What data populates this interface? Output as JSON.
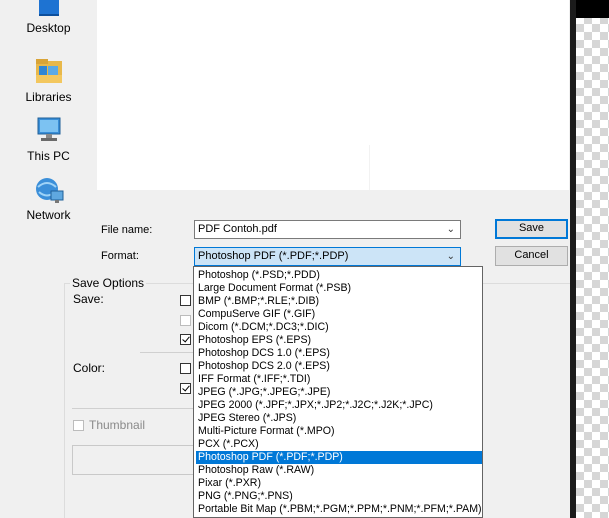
{
  "places": [
    {
      "label": "Desktop",
      "icon": "desktop-icon"
    },
    {
      "label": "Libraries",
      "icon": "libraries-icon"
    },
    {
      "label": "This PC",
      "icon": "this-pc-icon"
    },
    {
      "label": "Network",
      "icon": "network-icon"
    }
  ],
  "file_name": {
    "label": "File name:",
    "value": "PDF Contoh.pdf"
  },
  "format": {
    "label": "Format:",
    "value": "Photoshop PDF (*.PDF;*.PDP)"
  },
  "buttons": {
    "save": "Save",
    "cancel": "Cancel"
  },
  "save_options": {
    "title": "Save Options",
    "save_label": "Save:",
    "color_label": "Color:",
    "thumbnail_label": "Thumbnail"
  },
  "format_options": [
    "Photoshop (*.PSD;*.PDD)",
    "Large Document Format (*.PSB)",
    "BMP (*.BMP;*.RLE;*.DIB)",
    "CompuServe GIF (*.GIF)",
    "Dicom (*.DCM;*.DC3;*.DIC)",
    "Photoshop EPS (*.EPS)",
    "Photoshop DCS 1.0 (*.EPS)",
    "Photoshop DCS 2.0 (*.EPS)",
    "IFF Format (*.IFF;*.TDI)",
    "JPEG (*.JPG;*.JPEG;*.JPE)",
    "JPEG 2000 (*.JPF;*.JPX;*.JP2;*.J2C;*.J2K;*.JPC)",
    "JPEG Stereo (*.JPS)",
    "Multi-Picture Format (*.MPO)",
    "PCX (*.PCX)",
    "Photoshop PDF (*.PDF;*.PDP)",
    "Photoshop Raw (*.RAW)",
    "Pixar (*.PXR)",
    "PNG (*.PNG;*.PNS)",
    "Portable Bit Map (*.PBM;*.PGM;*.PPM;*.PNM;*.PFM;*.PAM)"
  ],
  "selected_format_index": 14,
  "colors": {
    "accent": "#0078d7",
    "selection_bg": "#cce4f7"
  }
}
